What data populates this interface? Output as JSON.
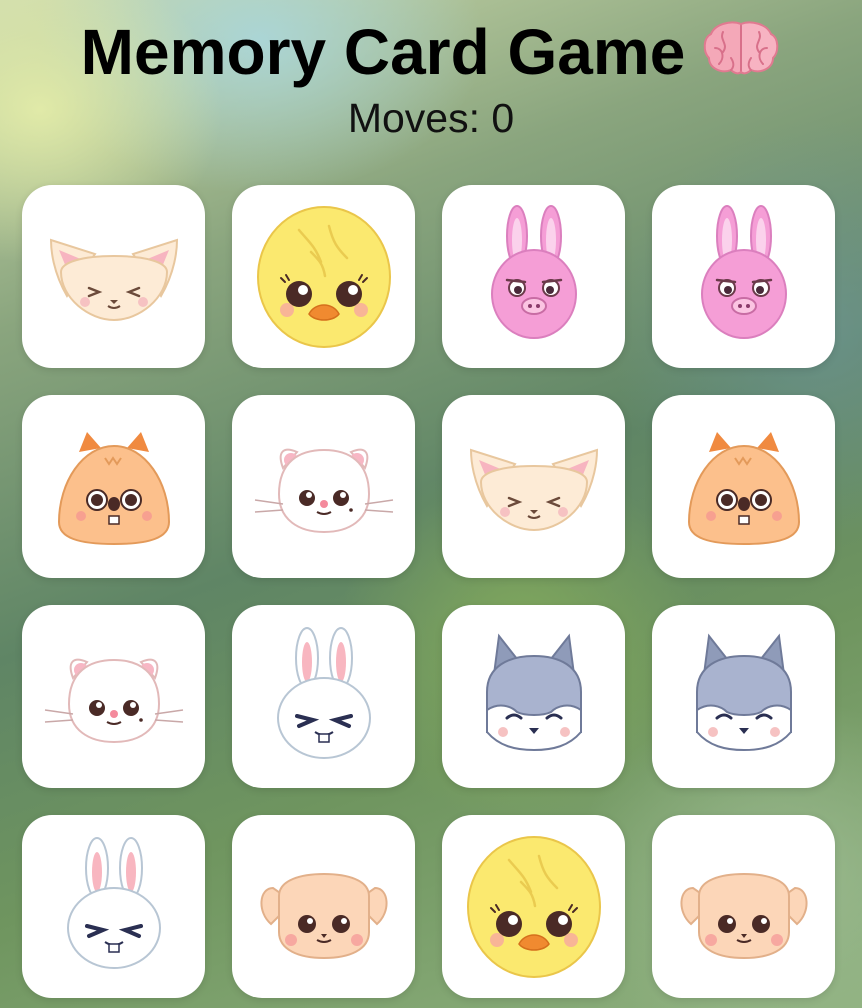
{
  "header": {
    "title": "Memory Card Game",
    "moves_text": "Moves: 0"
  },
  "board": {
    "rows": 4,
    "cols": 4,
    "cards": [
      {
        "character": "fox"
      },
      {
        "character": "chick"
      },
      {
        "character": "pig"
      },
      {
        "character": "pig"
      },
      {
        "character": "squirrel"
      },
      {
        "character": "cat"
      },
      {
        "character": "fox"
      },
      {
        "character": "squirrel"
      },
      {
        "character": "cat"
      },
      {
        "character": "bunny"
      },
      {
        "character": "wolf"
      },
      {
        "character": "wolf"
      },
      {
        "character": "bunny"
      },
      {
        "character": "puppy"
      },
      {
        "character": "chick"
      },
      {
        "character": "puppy"
      }
    ]
  }
}
